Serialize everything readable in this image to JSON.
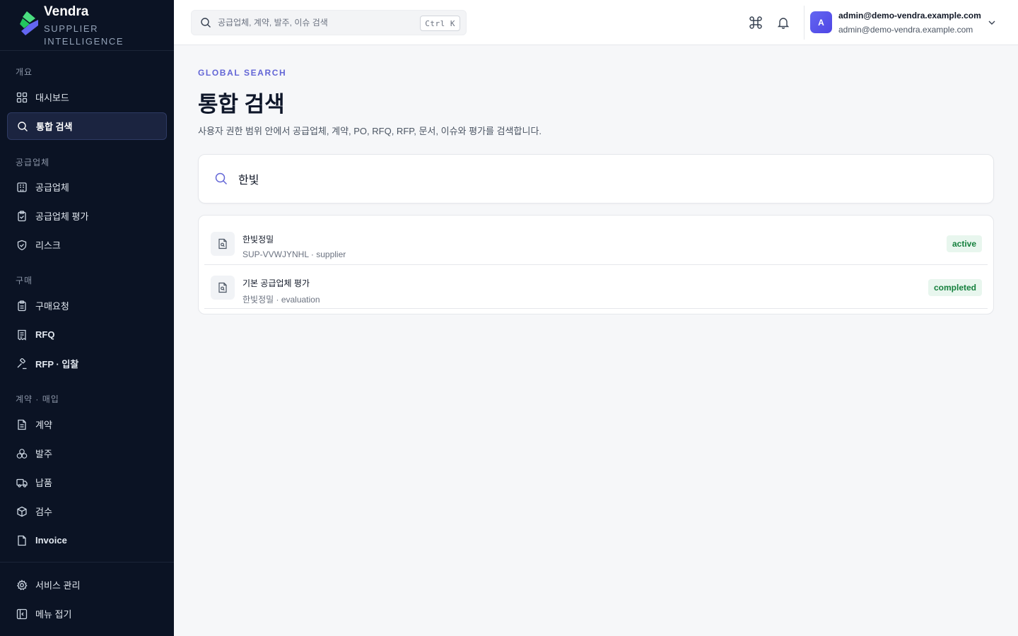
{
  "brand": {
    "name": "Vendra",
    "subtitle": "SUPPLIER INTELLIGENCE"
  },
  "sidebar": {
    "sections": [
      {
        "label": "개요"
      },
      {
        "label": "공급업체"
      },
      {
        "label": "구매"
      },
      {
        "label": "계약 · 매입"
      }
    ],
    "items": [
      {
        "label": "대시보드",
        "icon": "dashboard-icon"
      },
      {
        "label": "통합 검색",
        "icon": "search-icon",
        "active": true
      },
      {
        "label": "공급업체",
        "icon": "building-icon"
      },
      {
        "label": "공급업체 평가",
        "icon": "clipboard-check-icon"
      },
      {
        "label": "리스크",
        "icon": "shield-check-icon"
      },
      {
        "label": "구매요청",
        "icon": "clipboard-icon"
      },
      {
        "label": "RFQ",
        "icon": "receipt-icon"
      },
      {
        "label": "RFP · 입찰",
        "icon": "gavel-icon"
      },
      {
        "label": "계약",
        "icon": "document-icon"
      },
      {
        "label": "발주",
        "icon": "boxes-icon"
      },
      {
        "label": "납품",
        "icon": "truck-icon"
      },
      {
        "label": "검수",
        "icon": "package-icon"
      },
      {
        "label": "Invoice",
        "icon": "invoice-icon"
      }
    ],
    "footer": [
      {
        "label": "서비스 관리",
        "icon": "gear-icon"
      },
      {
        "label": "메뉴 접기",
        "icon": "collapse-sidebar-icon"
      }
    ]
  },
  "topbar": {
    "search_placeholder": "공급업체, 계약, 발주, 이슈 검색",
    "shortcut": "Ctrl K",
    "user": {
      "initial": "A",
      "name": "admin@demo-vendra.example.com",
      "email": "admin@demo-vendra.example.com"
    }
  },
  "main": {
    "eyebrow": "GLOBAL SEARCH",
    "title": "통합 검색",
    "description": "사용자 권한 범위 안에서 공급업체, 계약, PO, RFQ, RFP, 문서, 이슈와 평가를 검색합니다.",
    "query": "한빛"
  },
  "results": [
    {
      "title": "한빛정밀",
      "subtitle": "SUP-VVWJYNHL · supplier",
      "status": "active"
    },
    {
      "title": "기본 공급업체 평가",
      "subtitle": "한빛정밀 · evaluation",
      "status": "completed"
    }
  ],
  "colors": {
    "sidebar_bg": "#0b1324",
    "accent": "#6366d6",
    "badge_bg": "#e8f6ee",
    "badge_text": "#15803d"
  }
}
